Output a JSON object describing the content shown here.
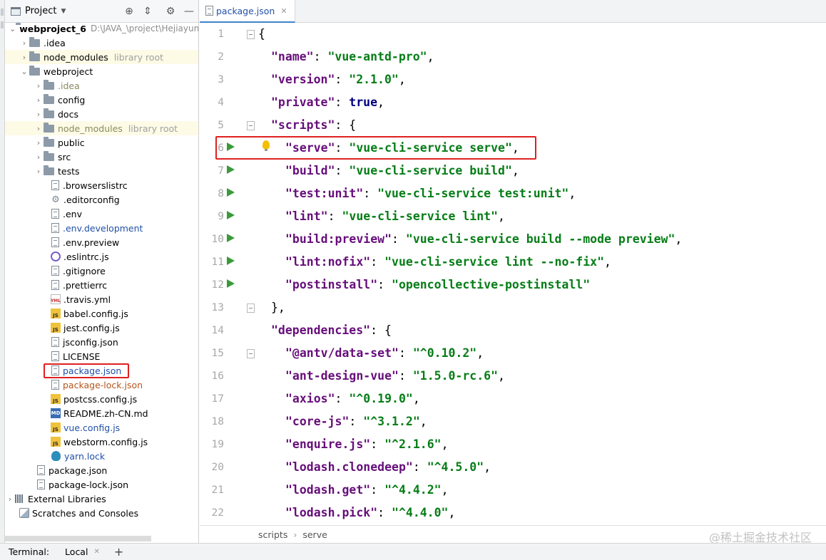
{
  "project_panel": {
    "title": "Project",
    "tree": [
      {
        "label": "webproject_6",
        "note": "D:\\JAVA_\\project\\Hejiayun",
        "kind": "folder"
      },
      {
        "label": ".idea",
        "kind": "folder"
      },
      {
        "label": "node_modules",
        "note": "library root",
        "kind": "folder"
      },
      {
        "label": "webproject",
        "kind": "folder"
      },
      {
        "label": ".idea",
        "kind": "folder"
      },
      {
        "label": "config",
        "kind": "folder"
      },
      {
        "label": "docs",
        "kind": "folder"
      },
      {
        "label": "node_modules",
        "note": "library root",
        "kind": "folder"
      },
      {
        "label": "public",
        "kind": "folder"
      },
      {
        "label": "src",
        "kind": "folder"
      },
      {
        "label": "tests",
        "kind": "folder"
      },
      {
        "label": ".browserslistrc",
        "kind": "file"
      },
      {
        "label": ".editorconfig",
        "kind": "config"
      },
      {
        "label": ".env",
        "kind": "file"
      },
      {
        "label": ".env.development",
        "kind": "file"
      },
      {
        "label": ".env.preview",
        "kind": "file"
      },
      {
        "label": ".eslintrc.js",
        "kind": "eslint"
      },
      {
        "label": ".gitignore",
        "kind": "file"
      },
      {
        "label": ".prettierrc",
        "kind": "file"
      },
      {
        "label": ".travis.yml",
        "kind": "yml"
      },
      {
        "label": "babel.config.js",
        "kind": "js"
      },
      {
        "label": "jest.config.js",
        "kind": "js"
      },
      {
        "label": "jsconfig.json",
        "kind": "json"
      },
      {
        "label": "LICENSE",
        "kind": "file"
      },
      {
        "label": "package.json",
        "kind": "json"
      },
      {
        "label": "package-lock.json",
        "kind": "json"
      },
      {
        "label": "postcss.config.js",
        "kind": "js"
      },
      {
        "label": "README.zh-CN.md",
        "kind": "md"
      },
      {
        "label": "vue.config.js",
        "kind": "js"
      },
      {
        "label": "webstorm.config.js",
        "kind": "js"
      },
      {
        "label": "yarn.lock",
        "kind": "yarn"
      },
      {
        "label": "package.json",
        "kind": "json"
      },
      {
        "label": "package-lock.json",
        "kind": "json"
      },
      {
        "label": "External Libraries",
        "kind": "library"
      },
      {
        "label": "Scratches and Consoles",
        "kind": "scratch"
      }
    ]
  },
  "editor": {
    "tab_label": "package.json",
    "line_numbers": [
      "1",
      "2",
      "3",
      "4",
      "5",
      "6",
      "7",
      "8",
      "9",
      "10",
      "11",
      "12",
      "13",
      "14",
      "15",
      "16",
      "17",
      "18",
      "19",
      "20",
      "21",
      "22"
    ],
    "code": {
      "l1": "{",
      "l2_key": "\"name\"",
      "l2_val": "\"vue-antd-pro\"",
      "l3_key": "\"version\"",
      "l3_val": "\"2.1.0\"",
      "l4_key": "\"private\"",
      "l4_val": "true",
      "l5_key": "\"scripts\"",
      "l5_open": "{",
      "l6_key": "\"serve\"",
      "l6_val": "\"vue-cli-service serve\"",
      "l7_key": "\"build\"",
      "l7_val": "\"vue-cli-service build\"",
      "l8_key": "\"test:unit\"",
      "l8_val": "\"vue-cli-service test:unit\"",
      "l9_key": "\"lint\"",
      "l9_val": "\"vue-cli-service lint\"",
      "l10_key": "\"build:preview\"",
      "l10_val": "\"vue-cli-service build --mode preview\"",
      "l11_key": "\"lint:nofix\"",
      "l11_val": "\"vue-cli-service lint --no-fix\"",
      "l12_key": "\"postinstall\"",
      "l12_val": "\"opencollective-postinstall\"",
      "l13": "},",
      "l14_key": "\"dependencies\"",
      "l14_open": "{",
      "l15_key": "\"@antv/data-set\"",
      "l15_val": "\"^0.10.2\"",
      "l16_key": "\"ant-design-vue\"",
      "l16_val": "\"1.5.0-rc.6\"",
      "l17_key": "\"axios\"",
      "l17_val": "\"^0.19.0\"",
      "l18_key": "\"core-js\"",
      "l18_val": "\"^3.1.2\"",
      "l19_key": "\"enquire.js\"",
      "l19_val": "\"^2.1.6\"",
      "l20_key": "\"lodash.clonedeep\"",
      "l20_val": "\"^4.5.0\"",
      "l21_key": "\"lodash.get\"",
      "l21_val": "\"^4.4.2\"",
      "l22_key": "\"lodash.pick\"",
      "l22_val": "\"^4.4.0\""
    },
    "breadcrumb": [
      "scripts",
      "serve"
    ]
  },
  "watermark": "@稀土掘金技术社区",
  "terminal": {
    "label": "Terminal:",
    "tab": "Local"
  },
  "colors": {
    "json_key": "#660e7a",
    "json_string": "#067d17",
    "json_keyword": "#000080",
    "annotation_red": "#e02020",
    "run_green": "#3a9a3a"
  }
}
